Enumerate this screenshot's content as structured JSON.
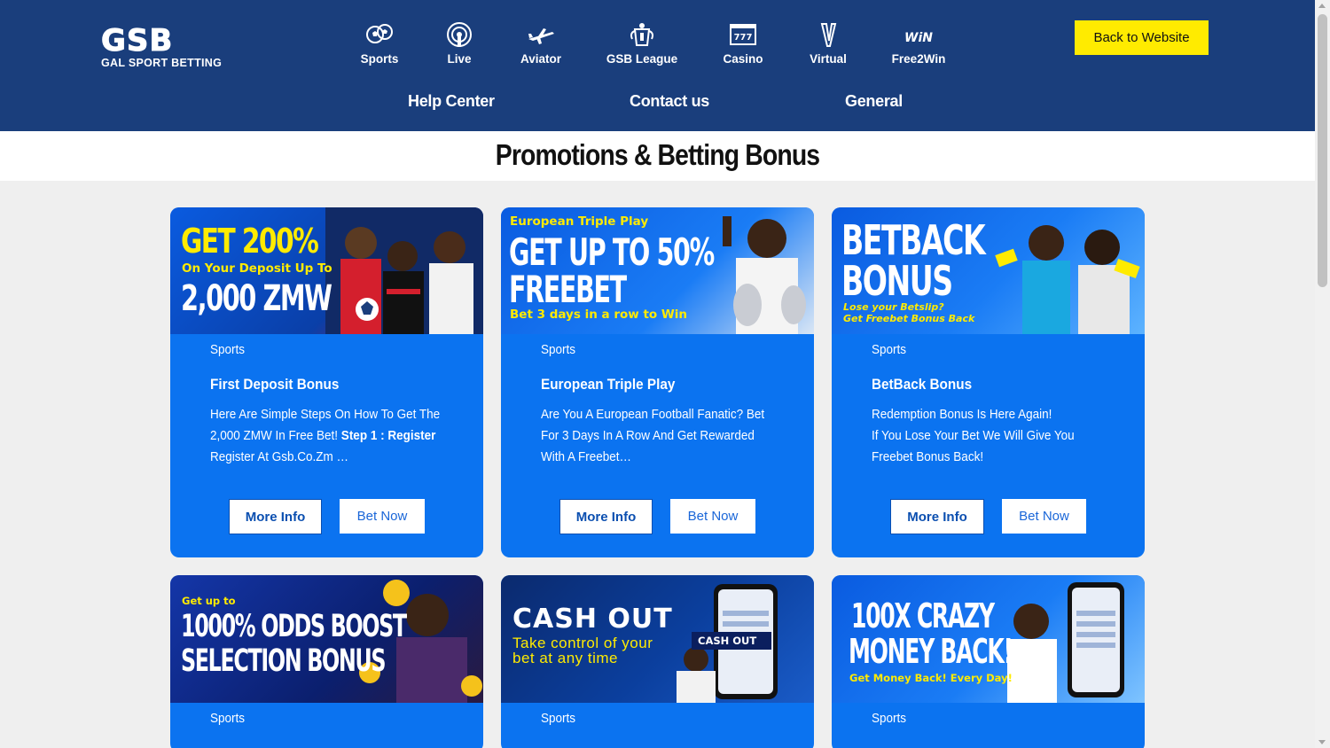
{
  "brand": {
    "logo_main": "GSB",
    "logo_sub": "GAL SPORT BETTING"
  },
  "nav": {
    "items": [
      {
        "label": "Sports",
        "icon": "soccer-balls-icon"
      },
      {
        "label": "Live",
        "icon": "live-broadcast-icon"
      },
      {
        "label": "Aviator",
        "icon": "airplane-icon"
      },
      {
        "label": "GSB League",
        "icon": "league-trophy-icon"
      },
      {
        "label": "Casino",
        "icon": "slot-machine-icon"
      },
      {
        "label": "Virtual",
        "icon": "virtual-icon"
      },
      {
        "label": "Free2Win",
        "icon": "free2win-icon"
      }
    ],
    "win_icon_text": "WiN",
    "slot_icon_text": "777",
    "subnav": [
      "Help Center",
      "Contact us",
      "General"
    ],
    "back_label": "Back to Website"
  },
  "page": {
    "title": "Promotions & Betting Bonus"
  },
  "colors": {
    "header": "#1a3e7c",
    "card": "#0b73f0",
    "accent_yellow": "#ffeb00"
  },
  "banners": {
    "b1": {
      "line1": "GET 200%",
      "line2": "On Your Deposit Up To",
      "line3": "2,000 ZMW"
    },
    "b2": {
      "line1": "European Triple Play",
      "line2": "GET UP TO 50%",
      "line3": "FREEBET",
      "line4": "Bet 3 days in a row to Win"
    },
    "b3": {
      "line1": "BETBACK",
      "line2": "BONUS",
      "line3": "Lose your Betslip?",
      "line4": "Get Freebet Bonus Back"
    },
    "b4": {
      "line1": "Get up to",
      "line2": "1000% ODDS BOOST",
      "line3": "SELECTION BONUS"
    },
    "b5": {
      "line1": "CASH OUT",
      "line2": "Take control of your",
      "line3": "bet at any time",
      "badge": "CASH OUT"
    },
    "b6": {
      "line1": "100X CRAZY",
      "line2": "MONEY BACK!",
      "line3": "Get Money Back! Every Day!"
    }
  },
  "cards": [
    {
      "category": "Sports",
      "title": "First Deposit Bonus",
      "desc_a": "Here Are Simple Steps On How To Get The 2,000 ZMW In Free Bet! ",
      "desc_bold": "Step 1 : Register",
      "desc_b": " Register At Gsb.Co.Zm …",
      "more": "More Info",
      "bet": "Bet Now"
    },
    {
      "category": "Sports",
      "title": "European Triple Play",
      "desc_a": "Are You A European Football Fanatic? Bet For 3 Days In A Row And Get Rewarded With A Freebet…",
      "more": "More Info",
      "bet": "Bet Now"
    },
    {
      "category": "Sports",
      "title": "BetBack Bonus",
      "desc_line1": "Redemption Bonus Is Here Again!",
      "desc_line2": "If You Lose Your Bet We Will Give You Freebet Bonus Back!",
      "more": "More Info",
      "bet": "Bet Now"
    },
    {
      "category": "Sports"
    },
    {
      "category": "Sports"
    },
    {
      "category": "Sports"
    }
  ]
}
